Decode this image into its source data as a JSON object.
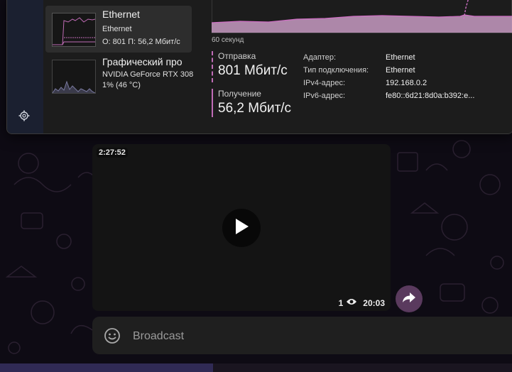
{
  "task_manager": {
    "items": [
      {
        "title": "Ethernet",
        "subtitle": "Ethernet",
        "detail": "О: 801 П: 56,2 Мбит/с",
        "selected": true
      },
      {
        "title": "Графический про",
        "subtitle": "NVIDIA GeForce RTX 308",
        "detail": "1% (46 °C)",
        "selected": false
      }
    ],
    "graph_label": "60 секунд",
    "send": {
      "label": "Отправка",
      "value": "801 Мбит/с"
    },
    "receive": {
      "label": "Получение",
      "value": "56,2 Мбит/с"
    },
    "properties": [
      {
        "key": "Адаптер:",
        "value": "Ethernet"
      },
      {
        "key": "Тип подключения:",
        "value": "Ethernet"
      },
      {
        "key": "IPv4-адрес:",
        "value": "192.168.0.2"
      },
      {
        "key": "IPv6-адрес:",
        "value": "fe80::6d21:8d0a:b392:e..."
      }
    ],
    "accent_color": "#c06cb6",
    "icons": {
      "settings": "gear-icon"
    }
  },
  "chat": {
    "video": {
      "duration": "2:27:52",
      "views": "1",
      "time": "20:03"
    },
    "composer": {
      "placeholder": "Broadcast"
    },
    "icons": {
      "play": "play-icon",
      "share": "share-icon",
      "emoji": "emoji-icon",
      "views": "eye-icon"
    }
  }
}
